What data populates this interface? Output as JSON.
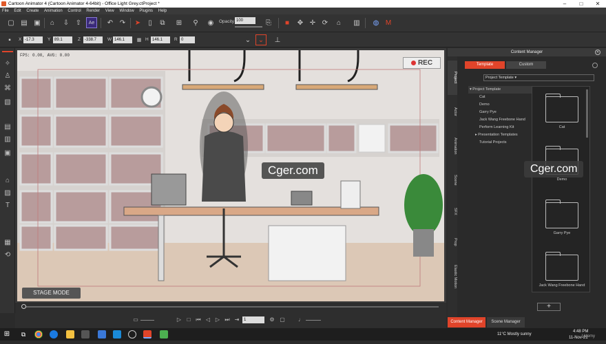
{
  "window": {
    "title": "Cartoon Animator 4  (Cartoon Animator 4-64bit) - Office Light Grey.ctProject *",
    "controls": [
      "–",
      "□",
      "✕"
    ]
  },
  "menu": [
    "File",
    "Edit",
    "Create",
    "Animation",
    "Control",
    "Render",
    "View",
    "Window",
    "Plugins",
    "Help"
  ],
  "toolbar": {
    "opacity_label": "Opacity",
    "opacity_value": "100"
  },
  "transform": {
    "x_label": "X",
    "x_value": "-17.3",
    "y_label": "Y",
    "y_value": "89.1",
    "z_label": "Z",
    "z_value": "-338.7",
    "w_label": "W",
    "w_value": "146.1",
    "h_label": "H",
    "h_value": "146.1",
    "r_label": "R",
    "r_value": "0"
  },
  "stage": {
    "fps_text": "FPS: 0.00, AVG: 0.00",
    "rec_label": "REC",
    "mode_label": "STAGE MODE",
    "watermark": "Cger.com"
  },
  "timeline": {
    "frame_value": "1"
  },
  "content_manager": {
    "title": "Content Manager",
    "vertical_tabs": [
      "Project",
      "Actor",
      "Animation",
      "Scene",
      "SFX",
      "Prop",
      "Elastic Motion"
    ],
    "tabs": [
      "Template",
      "Custom"
    ],
    "dropdown": "Project Template",
    "tree": [
      "Project Template",
      "Cat",
      "Demo",
      "Garry Pye",
      "Jack Wang Freebone Hand",
      "Perform Learning Kit",
      "Presentation Templates",
      "Tutorial Projects"
    ],
    "thumbnails": [
      "Cat",
      "Demo",
      "Garry Pye",
      "Jack Wang Freebone Hand"
    ],
    "add_button": "+",
    "watermark": "Cger.com"
  },
  "bottom_tabs": [
    "Content Manager",
    "Scene Manager"
  ],
  "taskbar": {
    "weather": "11°C  Mostly sunny",
    "time": "4:48 PM",
    "date": "11-Nov-21",
    "brand": "Udemy"
  },
  "colors": {
    "accent": "#e0442a",
    "panel": "#2a2a2a"
  }
}
